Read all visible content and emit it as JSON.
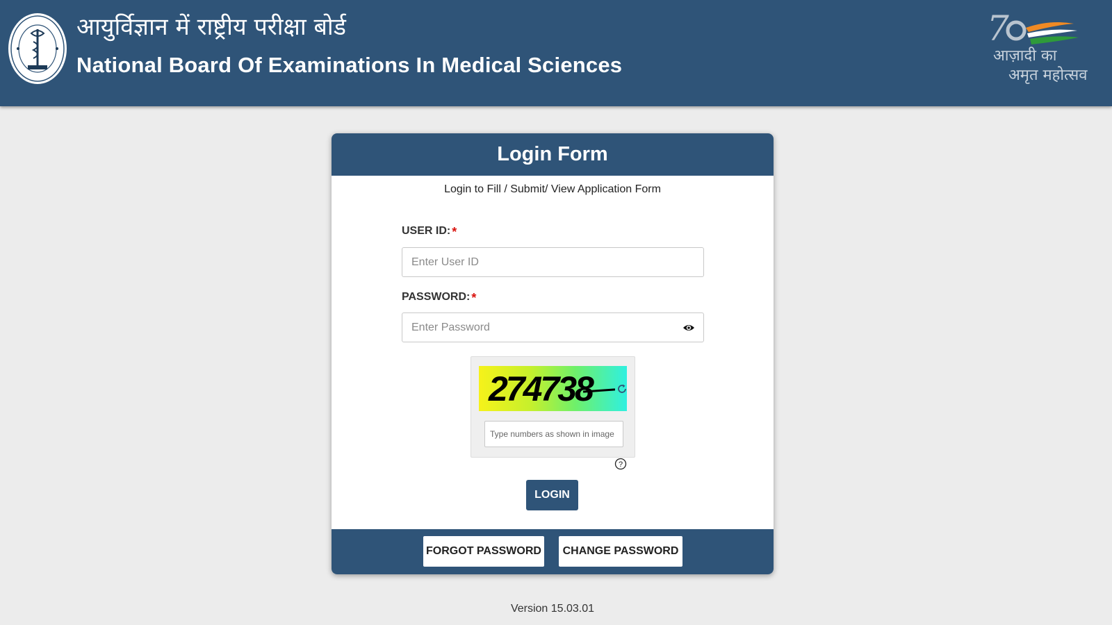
{
  "header": {
    "title_hindi": "आयुर्विज्ञान में राष्ट्रीय परीक्षा बोर्ड",
    "title_english": "National Board Of Examinations In Medical Sciences",
    "amrit_logo": {
      "number": "75",
      "line1": "आज़ादी का",
      "line2": "अमृत महोत्सव"
    }
  },
  "login_form": {
    "title": "Login Form",
    "subtitle": "Login to Fill / Submit/ View Application Form",
    "user_id": {
      "label": "USER ID:",
      "required_mark": "*",
      "placeholder": "Enter User ID",
      "value": ""
    },
    "password": {
      "label": "PASSWORD:",
      "required_mark": "*",
      "placeholder": "Enter Password",
      "value": ""
    },
    "captcha": {
      "code": "274738",
      "placeholder": "Type numbers as shown in image",
      "value": ""
    },
    "login_button": "LOGIN",
    "forgot_password_button": "FORGOT PASSWORD",
    "change_password_button": "CHANGE PASSWORD"
  },
  "version": "Version 15.03.01",
  "colors": {
    "primary": "#2f5478",
    "background": "#ececec",
    "required": "#d9140f"
  },
  "icons": [
    "nbems-seal-icon",
    "amrit-mahotsav-logo",
    "eye-icon",
    "refresh-icon",
    "help-icon"
  ]
}
